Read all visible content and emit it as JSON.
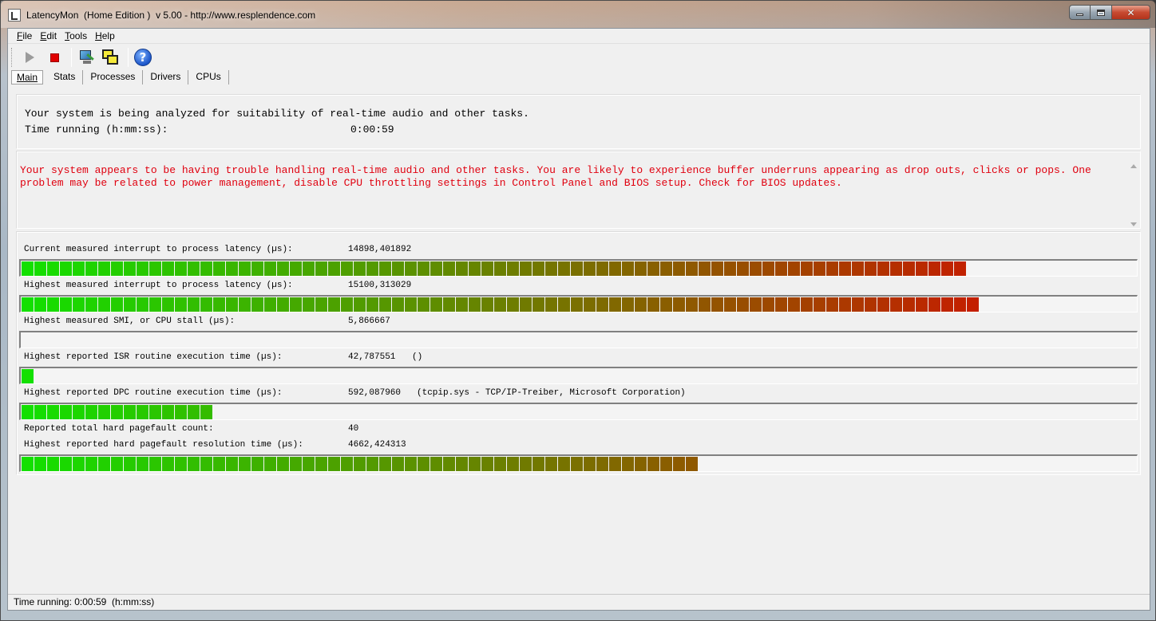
{
  "window": {
    "title": "LatencyMon  (Home Edition )  v 5.00 - http://www.resplendence.com",
    "min_label": "",
    "max_label": "",
    "close_label": "✕"
  },
  "menu": {
    "items": [
      {
        "label": "File",
        "accel": "F"
      },
      {
        "label": "Edit",
        "accel": "E"
      },
      {
        "label": "Tools",
        "accel": "T"
      },
      {
        "label": "Help",
        "accel": "H"
      }
    ]
  },
  "toolbar": {
    "icons": [
      "play-icon",
      "stop-icon",
      "monitor-settings-icon",
      "windows-icon",
      "help-icon"
    ],
    "help_glyph": "?"
  },
  "tabs": [
    "Main",
    "Stats",
    "Processes",
    "Drivers",
    "CPUs"
  ],
  "status_panel": {
    "line1": "Your system is being analyzed for suitability of real-time audio and other tasks.",
    "time_label": "Time running (h:mm:ss):",
    "time_value": "0:00:59"
  },
  "message": "Your system appears to be having trouble handling real-time audio and other tasks. You are likely to experience buffer underruns appearing as drop outs, clicks or pops. One problem may be related to power management, disable CPU throttling settings in Control Panel and BIOS setup. Check for BIOS updates.",
  "colors": {
    "message_text": "#e0000f",
    "meter_low": "#13e000",
    "meter_high": "#e00000"
  },
  "meters": [
    {
      "label": "Current measured interrupt to process latency (µs):",
      "value": "14898,401892",
      "extra": "",
      "bar": true,
      "level": 0.845
    },
    {
      "label": "Highest measured interrupt to process latency (µs):",
      "value": "15100,313029",
      "extra": "",
      "bar": true,
      "level": 0.857
    },
    {
      "label": "Highest measured SMI, or CPU stall (µs):",
      "value": "5,866667",
      "extra": "",
      "bar": true,
      "level": 0
    },
    {
      "label": "Highest reported ISR routine execution time (µs):",
      "value": "42,787551",
      "extra": "()",
      "bar": true,
      "level": 0.011
    },
    {
      "label": "Highest reported DPC routine execution time (µs):",
      "value": "592,087960",
      "extra": "(tcpip.sys - TCP/IP-Treiber, Microsoft Corporation)",
      "bar": true,
      "level": 0.171
    },
    {
      "label": "Reported total hard pagefault count:",
      "value": "40",
      "extra": "",
      "bar": false,
      "level": 0
    },
    {
      "label": "Highest reported hard pagefault resolution time (µs):",
      "value": "4662,424313",
      "extra": "",
      "bar": true,
      "level": 0.606
    }
  ],
  "statusbar": {
    "text": "Time running: 0:00:59  (h:mm:ss)"
  }
}
